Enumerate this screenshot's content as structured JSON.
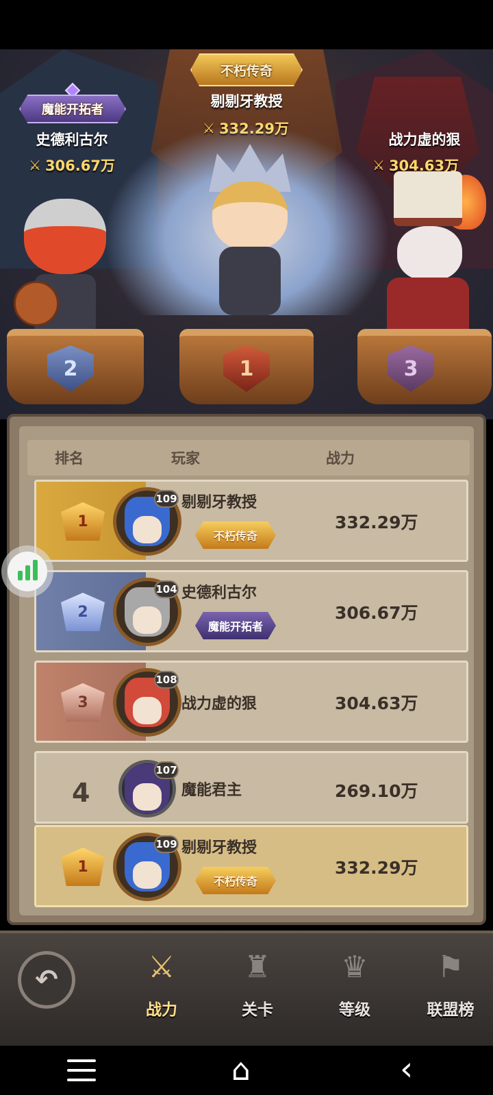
{
  "podium": {
    "first": {
      "title": "不朽传奇",
      "name": "剔剔牙教授",
      "power": "332.29万",
      "rank": "1"
    },
    "second": {
      "title": "魔能开拓者",
      "name": "史德利古尔",
      "power": "306.67万",
      "rank": "2"
    },
    "third": {
      "name": "战力虚的狠",
      "power": "304.63万",
      "rank": "3"
    }
  },
  "leaderboard": {
    "headers": {
      "rank": "排名",
      "player": "玩家",
      "power": "战力"
    },
    "rows": [
      {
        "rank": "1",
        "level": "109",
        "name": "剔剔牙教授",
        "title": "不朽传奇",
        "power": "332.29万"
      },
      {
        "rank": "2",
        "level": "104",
        "name": "史德利古尔",
        "title": "魔能开拓者",
        "power": "306.67万"
      },
      {
        "rank": "3",
        "level": "108",
        "name": "战力虚的狠",
        "power": "304.63万"
      },
      {
        "rank": "4",
        "level": "107",
        "name": "魔能君主",
        "power": "269.10万"
      }
    ],
    "self": {
      "rank": "1",
      "level": "109",
      "name": "剔剔牙教授",
      "title": "不朽传奇",
      "power": "332.29万"
    }
  },
  "tabs": [
    {
      "label": "战力",
      "icon": "crossed-swords-icon",
      "active": true
    },
    {
      "label": "关卡",
      "icon": "tower-icon",
      "active": false
    },
    {
      "label": "等级",
      "icon": "trophy-icon",
      "active": false
    },
    {
      "label": "联盟榜",
      "icon": "banner-icon",
      "active": false
    }
  ],
  "colors": {
    "gold": "#d9a93f",
    "silver": "#7080a8",
    "bronze": "#c0826a",
    "active_tab": "#ffe08a"
  }
}
